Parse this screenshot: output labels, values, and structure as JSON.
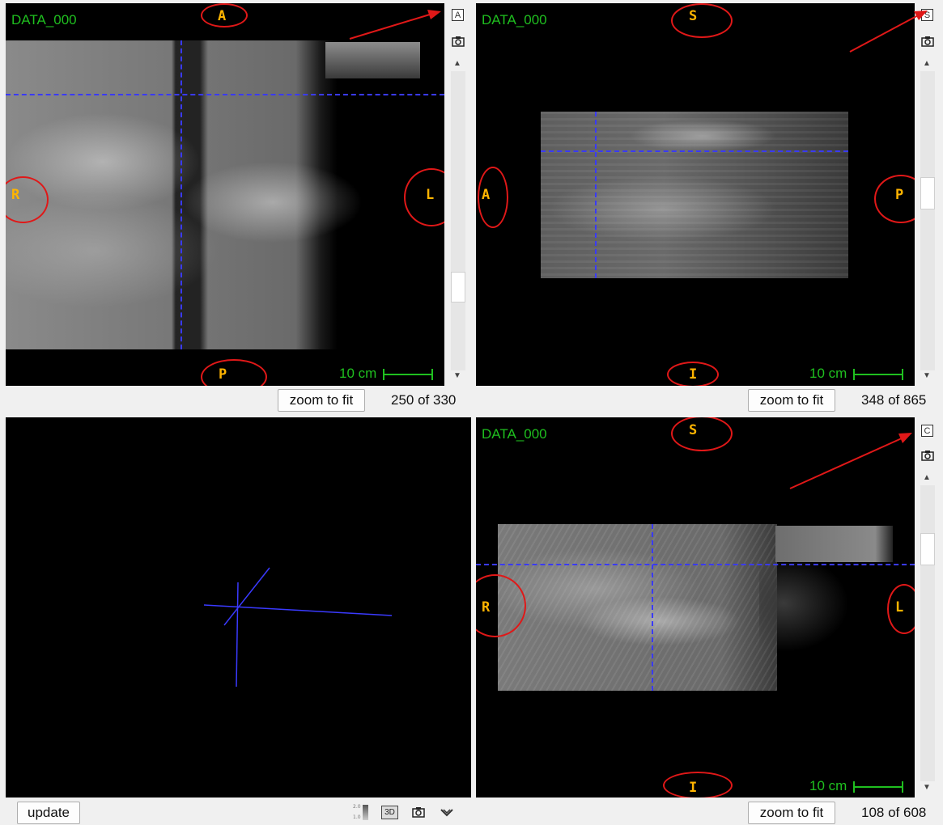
{
  "views": {
    "axial": {
      "title": "DATA_000",
      "orient": {
        "top": "A",
        "bottom": "P",
        "left": "R",
        "right": "L"
      },
      "scale_label": "10 cm",
      "axis_button": "A",
      "zoom_label": "zoom to fit",
      "slice": "250 of 330"
    },
    "sagittal": {
      "title": "DATA_000",
      "orient": {
        "top": "S",
        "bottom": "I",
        "left": "A",
        "right": "P"
      },
      "scale_label": "10 cm",
      "axis_button": "S",
      "zoom_label": "zoom to fit",
      "slice": "348 of 865"
    },
    "coronal": {
      "title": "DATA_000",
      "orient": {
        "top": "S",
        "bottom": "I",
        "left": "R",
        "right": "L"
      },
      "scale_label": "10 cm",
      "axis_button": "C",
      "zoom_label": "zoom to fit",
      "slice": "108 of 608"
    },
    "render3d": {
      "update_label": "update",
      "threed_label": "3D",
      "legend_top": "2.0",
      "legend_bottom": "1.0"
    }
  },
  "icons": [
    "camera-icon",
    "scroll-up-icon",
    "scroll-down-icon",
    "3d-icon",
    "chevron-down-icon",
    "colormap-icon"
  ],
  "colors": {
    "label": "#1fbf1f",
    "orientation": "#ffb400",
    "crosshair": "#3a3aff",
    "annotation": "#e01818"
  }
}
